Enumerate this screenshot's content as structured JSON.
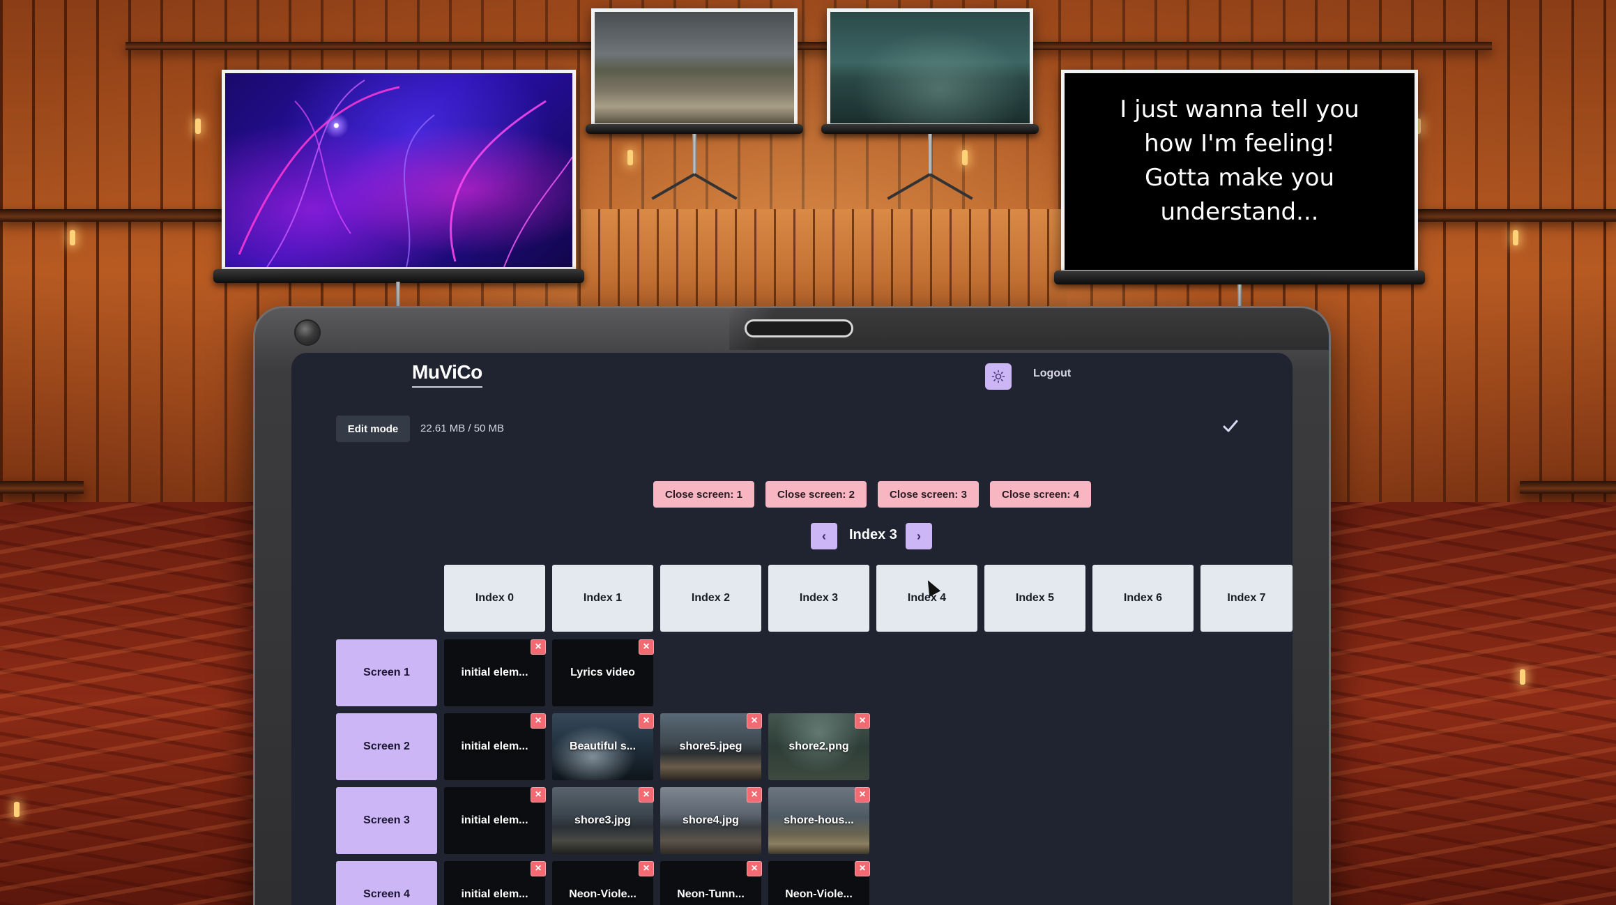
{
  "projectors": {
    "lyrics_text": "I just wanna tell you\nhow I'm feeling!\nGotta make you\nunderstand..."
  },
  "header": {
    "brand": "MuViCo",
    "theme_icon": "sun-icon",
    "logout_label": "Logout"
  },
  "toolbar": {
    "edit_mode_label": "Edit mode",
    "storage_usage": "22.61 MB / 50 MB",
    "confirm_icon": "check-icon"
  },
  "close_buttons": [
    "Close screen: 1",
    "Close screen: 2",
    "Close screen: 3",
    "Close screen: 4"
  ],
  "index_nav": {
    "prev_label": "‹",
    "next_label": "›",
    "current": "Index 3"
  },
  "index_columns": [
    "Index 0",
    "Index 1",
    "Index 2",
    "Index 3",
    "Index 4",
    "Index 5",
    "Index 6",
    "Index 7"
  ],
  "screens": [
    {
      "label": "Screen 1",
      "cells": [
        "initial elem...",
        "Lyrics video"
      ]
    },
    {
      "label": "Screen 2",
      "cells": [
        "initial elem...",
        "Beautiful s...",
        "shore5.jpeg",
        "shore2.png"
      ]
    },
    {
      "label": "Screen 3",
      "cells": [
        "initial elem...",
        "shore3.jpg",
        "shore4.jpg",
        "shore-hous..."
      ]
    },
    {
      "label": "Screen 4",
      "cells": [
        "initial elem...",
        "Neon-Viole...",
        "Neon-Tunn...",
        "Neon-Viole..."
      ]
    }
  ],
  "delete_symbol": "×",
  "colors": {
    "accent_lavender": "#cdb6f5",
    "close_pink": "#f7b6c2",
    "delete_red": "#f36a72",
    "app_background": "#1f2430",
    "index_header_bg": "#e4e8ef"
  }
}
